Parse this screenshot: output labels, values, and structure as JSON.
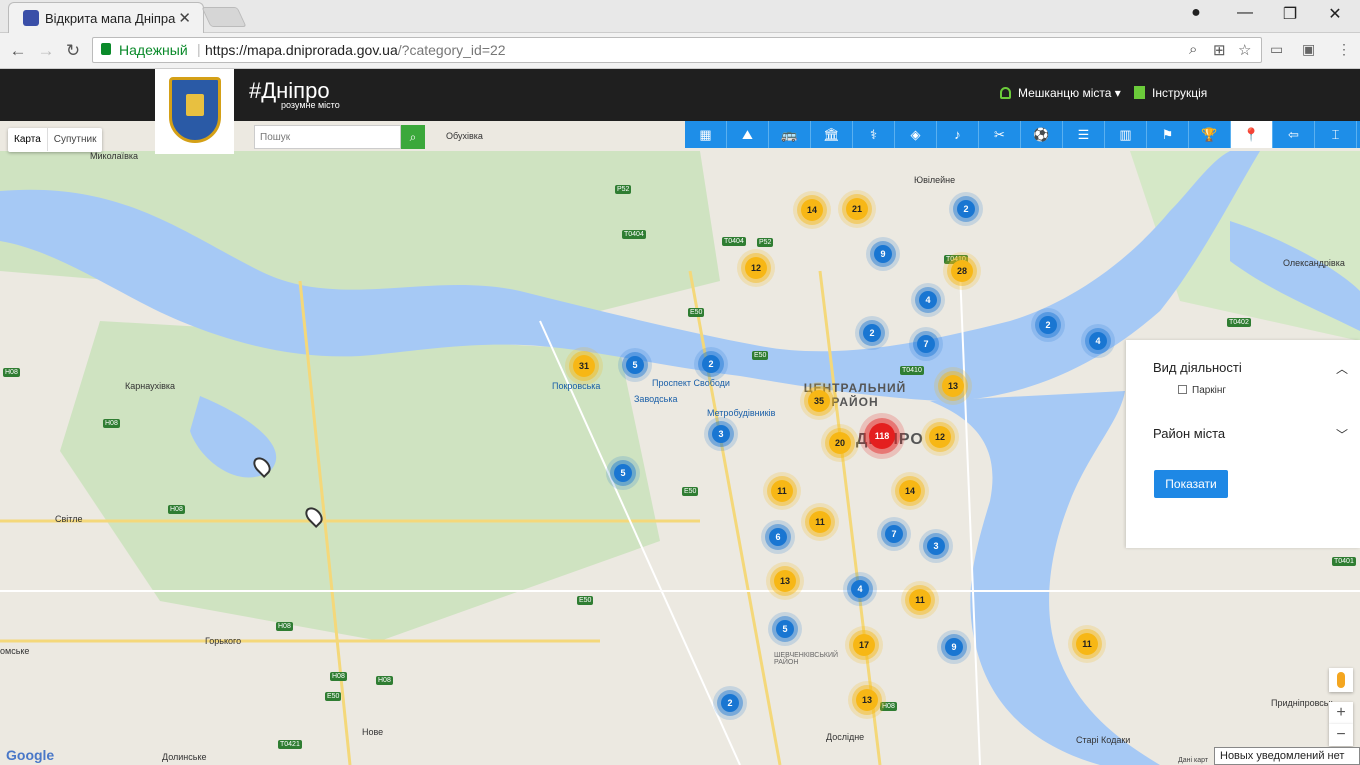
{
  "browser": {
    "tab_title": "Відкрита мапа Дніпра",
    "secure_label": "Надежный",
    "url_host": "https://mapa.dniprorada.gov.ua",
    "url_path": "/?category_id=22"
  },
  "site": {
    "brand": "#Дніпро",
    "brand_sub": "розумне місто",
    "residents_menu": "Мешканцю міста",
    "instructions": "Інструкція",
    "search_placeholder": "Пошук"
  },
  "map_types": [
    "Карта",
    "Супутник"
  ],
  "categories": [
    "building",
    "landscape",
    "transport",
    "museum",
    "medicine",
    "sport",
    "music",
    "tools",
    "soccer",
    "theater",
    "bank",
    "sign",
    "trophy",
    "location",
    "back",
    "monument"
  ],
  "active_category_index": 13,
  "clusters": [
    {
      "n": "14",
      "c": "y"
    },
    {
      "n": "21",
      "c": "y"
    },
    {
      "n": "2",
      "c": "b"
    },
    {
      "n": "9",
      "c": "b"
    },
    {
      "n": "28",
      "c": "y"
    },
    {
      "n": "12",
      "c": "y"
    },
    {
      "n": "4",
      "c": "b"
    },
    {
      "n": "2",
      "c": "b"
    },
    {
      "n": "7",
      "c": "b"
    },
    {
      "n": "2",
      "c": "b"
    },
    {
      "n": "4",
      "c": "b"
    },
    {
      "n": "31",
      "c": "y"
    },
    {
      "n": "5",
      "c": "b"
    },
    {
      "n": "2",
      "c": "b"
    },
    {
      "n": "13",
      "c": "y"
    },
    {
      "n": "35",
      "c": "y"
    },
    {
      "n": "20",
      "c": "y"
    },
    {
      "n": "118",
      "c": "r"
    },
    {
      "n": "12",
      "c": "y"
    },
    {
      "n": "3",
      "c": "b"
    },
    {
      "n": "5",
      "c": "b"
    },
    {
      "n": "11",
      "c": "y"
    },
    {
      "n": "14",
      "c": "y"
    },
    {
      "n": "11",
      "c": "y"
    },
    {
      "n": "6",
      "c": "b"
    },
    {
      "n": "7",
      "c": "b"
    },
    {
      "n": "3",
      "c": "b"
    },
    {
      "n": "13",
      "c": "y"
    },
    {
      "n": "4",
      "c": "b"
    },
    {
      "n": "11",
      "c": "y"
    },
    {
      "n": "5",
      "c": "b"
    },
    {
      "n": "17",
      "c": "y"
    },
    {
      "n": "9",
      "c": "b"
    },
    {
      "n": "11",
      "c": "y"
    },
    {
      "n": "2",
      "c": "b"
    },
    {
      "n": "13",
      "c": "y"
    }
  ],
  "place_labels": [
    "Миколаївка",
    "Обухівка",
    "Ювілейне",
    "Олександрівка",
    "Карнаухівка",
    "Покровська",
    "Проспект Свободи",
    "Заводська",
    "Метробудівників",
    "Світле",
    "Горького",
    "омське",
    "Нове",
    "Долинське",
    "Дослідне",
    "Старі Кодаки",
    "Придніпровськ",
    "ЦЕНТРАЛЬНИЙ РАЙОН",
    "ДНІПРО",
    "ШЕВЧЕНКІВСЬКИЙ РАЙОН"
  ],
  "road_labels": [
    "P52",
    "T0404",
    "T0404",
    "P52",
    "E50",
    "E50",
    "H08",
    "H08",
    "H08",
    "E50",
    "E50",
    "H08",
    "H08",
    "T0410",
    "T0410",
    "T0402",
    "T0401",
    "H08",
    "E50",
    "T0421",
    "H08"
  ],
  "panel": {
    "activity_title": "Вид діяльності",
    "activity_option": "Паркінг",
    "district_title": "Район міста",
    "show_button": "Показати"
  },
  "notification": "Новых уведомлений нет",
  "attribution": "Дані карт"
}
